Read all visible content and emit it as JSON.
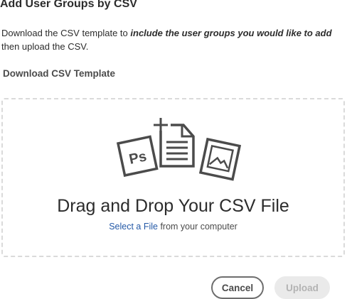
{
  "dialog": {
    "title": "Add User Groups by CSV",
    "description_pre": "Download the CSV template to ",
    "description_emphasis": "include the user groups you would like to add",
    "description_post": " then upload the CSV.",
    "download_link_label": "Download CSV Template"
  },
  "dropzone": {
    "icons": [
      "photoshop-file-icon",
      "document-add-icon",
      "image-file-icon"
    ],
    "title": "Drag and Drop Your CSV File",
    "select_link_label": "Select a File",
    "select_suffix": " from your computer"
  },
  "footer": {
    "cancel_label": "Cancel",
    "upload_label": "Upload",
    "upload_disabled": true
  },
  "colors": {
    "link": "#2459a7",
    "text": "#2c2c2c",
    "dashed_border": "#dadada",
    "disabled_bg": "#eaeaea",
    "icon_stroke": "#4b4b4b"
  }
}
